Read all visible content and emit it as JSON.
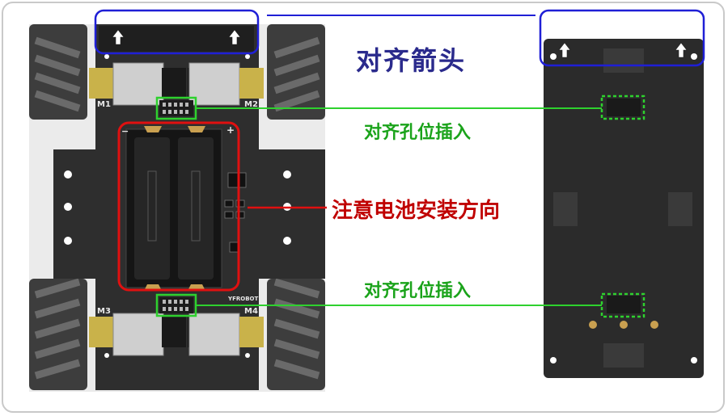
{
  "labels": {
    "align_arrows": "对齐箭头",
    "align_slot_top": "对齐孔位插入",
    "align_slot_bottom": "对齐孔位插入",
    "battery_direction": "注意电池安装方向"
  },
  "board": {
    "m1": "M1",
    "m2": "M2",
    "m3": "M3",
    "m4": "M4",
    "brand": "YFROBOT",
    "minus": "−",
    "plus": "+"
  },
  "colors": {
    "arrow_annotation": "#1f1fd6",
    "slot_annotation": "#2ed12e",
    "battery_annotation": "#e01010",
    "title_text": "#2a2a8c",
    "slot_text": "#1aa31a",
    "battery_text": "#c00000"
  },
  "icons": [
    "arrow-up-icon"
  ]
}
